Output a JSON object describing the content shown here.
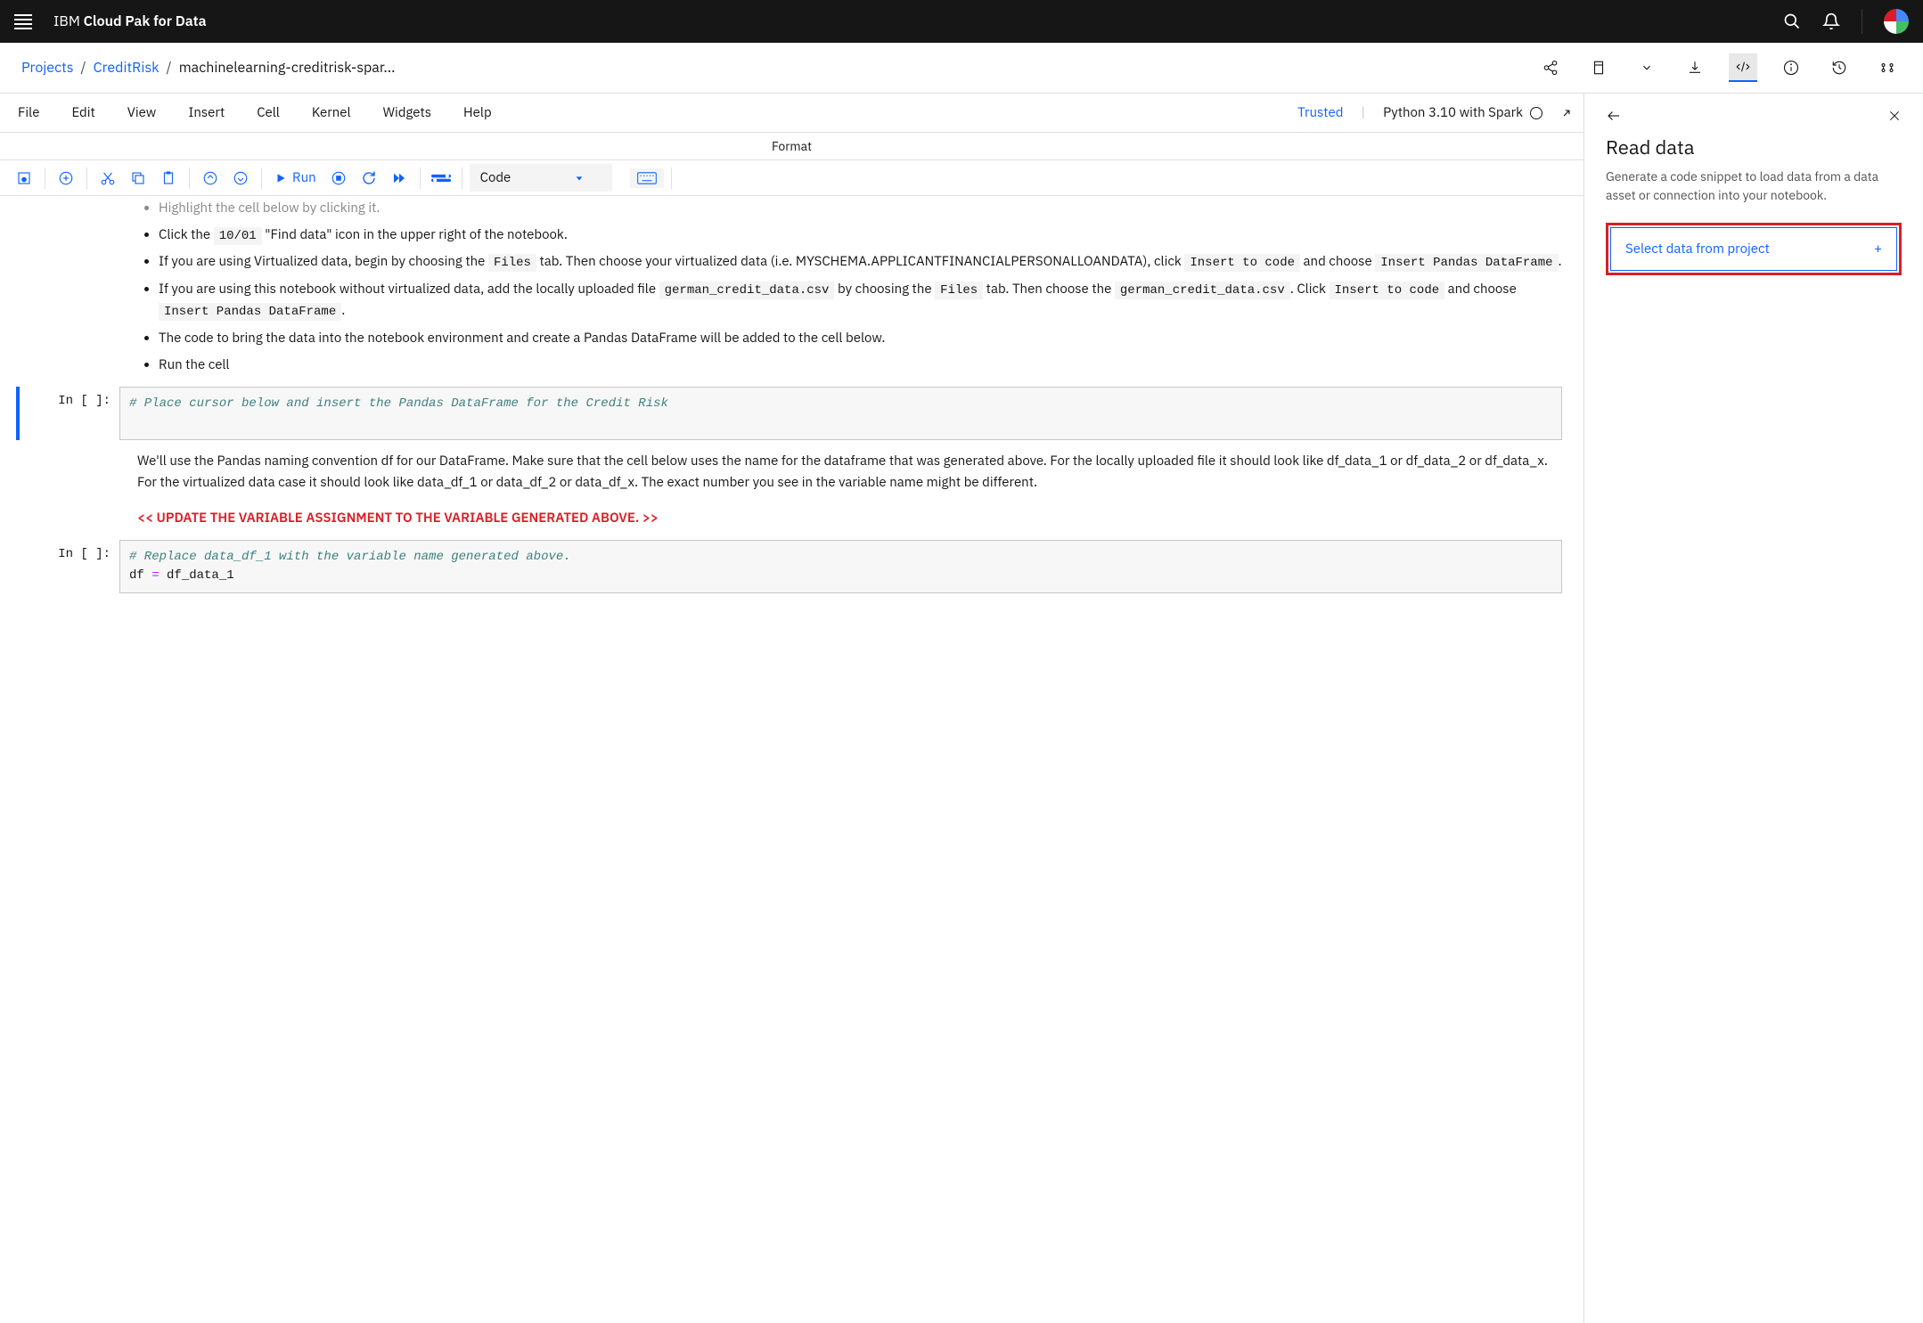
{
  "brand": {
    "prefix": "IBM",
    "strong": "Cloud Pak for Data"
  },
  "breadcrumb": {
    "projects": "Projects",
    "project_name": "CreditRisk",
    "notebook_name": "machinelearning-creditrisk-spar..."
  },
  "menu": {
    "file": "File",
    "edit": "Edit",
    "view": "View",
    "insert": "Insert",
    "cell": "Cell",
    "kernel": "Kernel",
    "widgets": "Widgets",
    "help": "Help",
    "trusted": "Trusted",
    "kernel_name": "Python 3.10 with Spark"
  },
  "format_label": "Format",
  "toolbar": {
    "run": "Run",
    "cell_type": "Code"
  },
  "content": {
    "bullet0": "Highlight the cell below by clicking it.",
    "bullet1_a": "Click the ",
    "bullet1_code": "10/01",
    "bullet1_b": " \"Find data\" icon in the upper right of the notebook.",
    "bullet2_a": "If you are using Virtualized data, begin by choosing the ",
    "bullet2_code1": "Files",
    "bullet2_b": " tab. Then choose your virtualized data (i.e. MYSCHEMA.APPLICANTFINANCIALPERSONALLOANDATA), click ",
    "bullet2_code2": "Insert to code",
    "bullet2_c": " and choose ",
    "bullet2_code3": "Insert Pandas DataFrame",
    "bullet2_d": ".",
    "bullet3_a": "If you are using this notebook without virtualized data, add the locally uploaded file ",
    "bullet3_code1": "german_credit_data.csv",
    "bullet3_b": " by choosing the ",
    "bullet3_code2": "Files",
    "bullet3_c": " tab. Then choose the ",
    "bullet3_code3": "german_credit_data.csv",
    "bullet3_d": ". Click ",
    "bullet3_code4": "Insert to code",
    "bullet3_e": " and choose ",
    "bullet3_code5": "Insert Pandas DataFrame",
    "bullet3_f": ".",
    "bullet4": "The code to bring the data into the notebook environment and create a Pandas DataFrame will be added to the cell below.",
    "bullet5": "Run the cell",
    "cell1_prompt": "In [ ]:",
    "cell1_comment": "# Place cursor below and insert the Pandas DataFrame for the Credit Risk",
    "md2_p": "We'll use the Pandas naming convention df for our DataFrame. Make sure that the cell below uses the name for the dataframe that was generated above. For the locally uploaded file it should look like df_data_1 or df_data_2 or df_data_x. For the virtualized data case it should look like data_df_1 or data_df_2 or data_df_x. The exact number you see in the variable name might be different.",
    "md2_red": "<< UPDATE THE VARIABLE ASSIGNMENT TO THE VARIABLE GENERATED ABOVE. >>",
    "cell2_prompt": "In [ ]:",
    "cell2_comment": "# Replace data_df_1 with the variable name generated above.",
    "cell2_code_a": "df ",
    "cell2_code_op": "=",
    "cell2_code_b": " df_data_1"
  },
  "panel": {
    "title": "Read data",
    "desc": "Generate a code snippet to load data from a data asset or connection into your notebook.",
    "select_btn": "Select data from project",
    "plus": "+"
  }
}
